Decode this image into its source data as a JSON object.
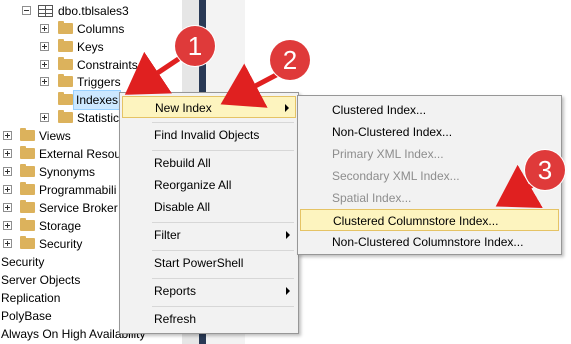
{
  "tree": {
    "items": [
      {
        "label": "dbo.tblsales3"
      },
      {
        "label": "Columns"
      },
      {
        "label": "Keys"
      },
      {
        "label": "Constraints"
      },
      {
        "label": "Triggers"
      },
      {
        "label": "Indexes"
      },
      {
        "label": "Statistic"
      },
      {
        "label": "Views"
      },
      {
        "label": "External Resour"
      },
      {
        "label": "Synonyms"
      },
      {
        "label": "Programmabili"
      },
      {
        "label": "Service Broker"
      },
      {
        "label": "Storage"
      },
      {
        "label": "Security"
      },
      {
        "label": "Security"
      },
      {
        "label": "Server Objects"
      },
      {
        "label": "Replication"
      },
      {
        "label": "PolyBase"
      },
      {
        "label": "Always On High Availability"
      }
    ]
  },
  "context_menu": {
    "items": [
      {
        "label": "New Index"
      },
      {
        "label": "Find Invalid Objects"
      },
      {
        "label": "Rebuild All"
      },
      {
        "label": "Reorganize All"
      },
      {
        "label": "Disable All"
      },
      {
        "label": "Filter"
      },
      {
        "label": "Start PowerShell"
      },
      {
        "label": "Reports"
      },
      {
        "label": "Refresh"
      }
    ]
  },
  "submenu": {
    "items": [
      {
        "label": "Clustered Index..."
      },
      {
        "label": "Non-Clustered Index..."
      },
      {
        "label": "Primary XML Index..."
      },
      {
        "label": "Secondary XML Index..."
      },
      {
        "label": "Spatial Index..."
      },
      {
        "label": "Clustered Columnstore Index..."
      },
      {
        "label": "Non-Clustered Columnstore Index..."
      }
    ]
  },
  "callouts": {
    "badge1": "1",
    "badge2": "2",
    "badge3": "3"
  },
  "colors": {
    "badge": "#df3a3a",
    "arrow": "#e02020",
    "hover_bg": "#fdf4bf",
    "selected_bg": "#cce8ff",
    "splitter_dark": "#293955"
  },
  "icons": {
    "table": "table-icon",
    "folder": "folder-icon",
    "expand": "expand-plus-icon",
    "collapse": "collapse-minus-icon",
    "submenu": "submenu-arrow-icon"
  }
}
